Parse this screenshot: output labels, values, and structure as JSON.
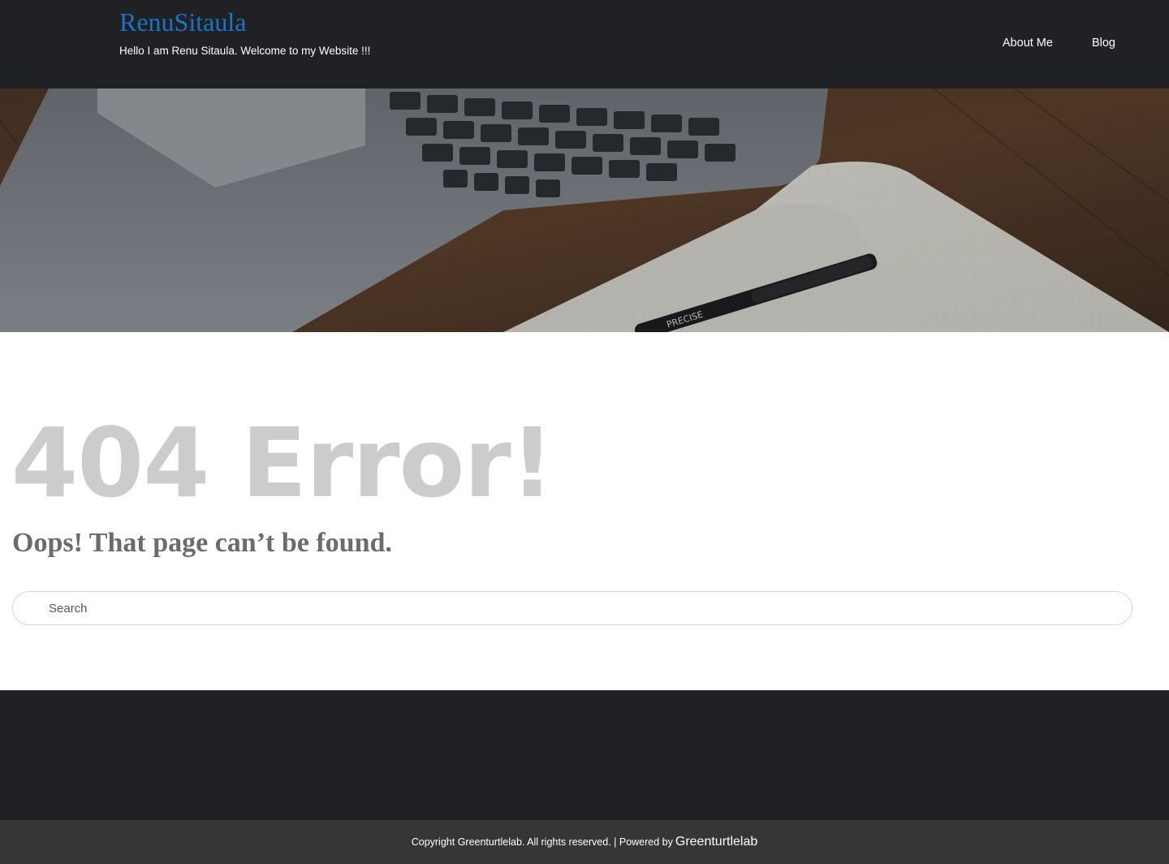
{
  "header": {
    "site_title": "RenuSitaula",
    "tagline": "Hello I am Renu Sitaula. Welcome to my Website !!!",
    "nav": [
      {
        "label": "About Me"
      },
      {
        "label": "Blog"
      }
    ]
  },
  "hero": {
    "image": "laptop-notebook-pen-photo",
    "pen_text": "PRECISE"
  },
  "error": {
    "title": "404 Error!",
    "subtitle": "Oops! That page can’t be found."
  },
  "search": {
    "placeholder": "Search",
    "value": ""
  },
  "footer": {
    "copyright": "Copyright Greenturtlelab. All rights reserved. | Powered by",
    "powered_by_link": "Greenturtlelab"
  },
  "colors": {
    "header_bg": "#202125",
    "title_blue": "#1b74c5",
    "error_gray": "#cccccc",
    "footer_bottom_bg": "#363636"
  }
}
